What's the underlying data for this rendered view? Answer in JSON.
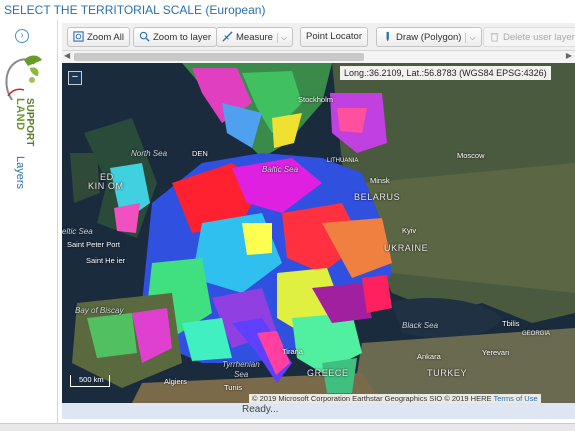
{
  "header": {
    "title": "SELECT THE TERRITORIAL SCALE (European)"
  },
  "sidebar": {
    "logo_land": "LAND",
    "logo_support": "SUPPORT",
    "layers_label": "Layers",
    "expand_icon": "chevron-right-icon"
  },
  "toolbar": {
    "zoom_all": "Zoom All",
    "zoom_to_layer": "Zoom to layer",
    "measure": "Measure",
    "point_locator": "Point Locator",
    "draw": "Draw (Polygon)",
    "delete_layer": "Delete user layer"
  },
  "map": {
    "coords": "Long.:36.2109, Lat.:56.8783 (WGS84 EPSG:4326)",
    "zoom_out": "−",
    "scale": "500 km",
    "attribution": "© 2019 Microsoft Corporation Earthstar Geographics SIO © 2019 HERE",
    "terms": "Terms of Use",
    "labels": {
      "stockholm": "Stockholm",
      "north_sea": "North Sea",
      "den": "DEN",
      "baltic_sea": "Baltic Sea",
      "lithuania": "LITHUANIA",
      "moscow": "Moscow",
      "minsk": "Minsk",
      "belarus": "BELARUS",
      "ed": "ED",
      "kingdom": "KIN  OM",
      "celtic_sea": "eltic Sea",
      "saint_peter_port": "Saint Peter Port",
      "saint_helier": "Saint He ier",
      "kyiv": "Kyiv",
      "ukraine": "UKRAINE",
      "bay_of_biscay": "Bay of Biscay",
      "black_sea": "Black Sea",
      "ankara": "Ankara",
      "yerevan": "Yerevan",
      "turkey": "TURKEY",
      "tyrrhenian": "Tyrrhenian",
      "sea": "Sea",
      "tirana": "Tirana",
      "algiers": "Algiers",
      "tunis": "Tunis",
      "greece": "GREECE",
      "tbilisi": "Tbilis",
      "georgia": "GEORGIA"
    }
  },
  "status": {
    "text": "Ready..."
  },
  "colors": {
    "accent": "#2a6fb0",
    "land_green": "#6a9a2a"
  }
}
